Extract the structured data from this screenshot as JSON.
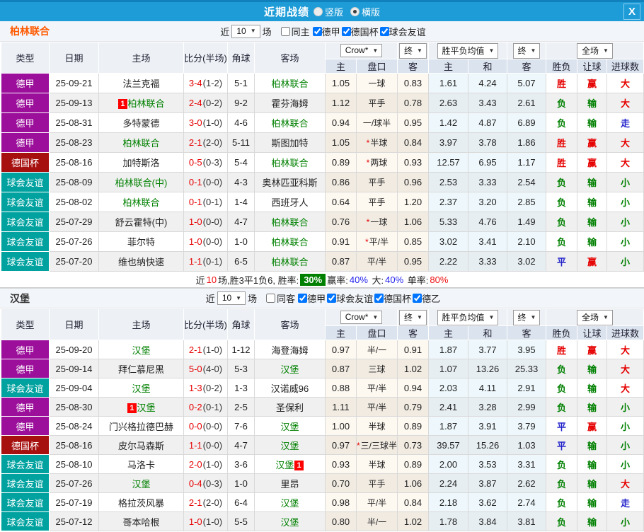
{
  "titlebar": {
    "title": "近期战绩",
    "radios": [
      {
        "label": "竖版",
        "checked": false
      },
      {
        "label": "横版",
        "checked": true
      }
    ],
    "close": "X"
  },
  "table_header": {
    "left_cols": [
      "类型",
      "日期",
      "主场",
      "比分(半场)",
      "角球",
      "客场"
    ],
    "sub_cols": [
      "主",
      "盘口",
      "客",
      "主",
      "和",
      "客",
      "胜负",
      "让球",
      "进球数"
    ],
    "dd_company": "Crow*",
    "dd_final1": "终",
    "dd_avg": "胜平负均值",
    "dd_final2": "终",
    "dd_scope": "全场"
  },
  "type_colors": {
    "德甲": "#9b0f9b",
    "德国杯": "#a6100f",
    "球会友谊": "#00a2a0",
    "德乙": "#9b0f9b"
  },
  "result_colors": {
    "胜": "#e60000",
    "负": "#008000",
    "平": "#2323cc",
    "赢": "#e60000",
    "输": "#008000",
    "大": "#e60000",
    "小": "#008000",
    "走": "#2323cc"
  },
  "sections": [
    {
      "team": "柏林联合",
      "name_color": "#ff5a00",
      "filter": {
        "near": "近",
        "count": "10",
        "games": "场",
        "same": "同主",
        "leagues": [
          {
            "label": "德甲",
            "checked": true
          },
          {
            "label": "德国杯",
            "checked": true
          },
          {
            "label": "球会友谊",
            "checked": true
          }
        ]
      },
      "rows": [
        {
          "type": "德甲",
          "date": "25-09-21",
          "home": "法兰克福",
          "home_green": false,
          "home_badge": "",
          "home_badge_pos": "",
          "away": "柏林联合",
          "away_green": true,
          "away_badge": "",
          "away_badge_pos": "",
          "score": "3-4",
          "half": "(1-2)",
          "corner": "5-1",
          "o_home": "1.05",
          "handicap": "一球",
          "handicap_star": false,
          "o_away": "0.83",
          "avg_home": "1.61",
          "avg_draw": "4.24",
          "avg_away": "5.07",
          "res_wdl": "胜",
          "res_handicap": "赢",
          "res_ou": "大"
        },
        {
          "type": "德甲",
          "date": "25-09-13",
          "home": "柏林联合",
          "home_green": true,
          "home_badge": "1",
          "home_badge_pos": "before",
          "away": "霍芬海姆",
          "away_green": false,
          "away_badge": "",
          "away_badge_pos": "",
          "score": "2-4",
          "half": "(0-2)",
          "corner": "9-2",
          "o_home": "1.12",
          "handicap": "平手",
          "handicap_star": false,
          "o_away": "0.78",
          "avg_home": "2.63",
          "avg_draw": "3.43",
          "avg_away": "2.61",
          "res_wdl": "负",
          "res_handicap": "输",
          "res_ou": "大"
        },
        {
          "type": "德甲",
          "date": "25-08-31",
          "home": "多特蒙德",
          "home_green": false,
          "home_badge": "",
          "home_badge_pos": "",
          "away": "柏林联合",
          "away_green": true,
          "away_badge": "",
          "away_badge_pos": "",
          "score": "3-0",
          "half": "(1-0)",
          "corner": "4-6",
          "o_home": "0.94",
          "handicap": "一/球半",
          "handicap_star": false,
          "o_away": "0.95",
          "avg_home": "1.42",
          "avg_draw": "4.87",
          "avg_away": "6.89",
          "res_wdl": "负",
          "res_handicap": "输",
          "res_ou": "走"
        },
        {
          "type": "德甲",
          "date": "25-08-23",
          "home": "柏林联合",
          "home_green": true,
          "home_badge": "",
          "home_badge_pos": "",
          "away": "斯图加特",
          "away_green": false,
          "away_badge": "",
          "away_badge_pos": "",
          "score": "2-1",
          "half": "(2-0)",
          "corner": "5-11",
          "o_home": "1.05",
          "handicap": "半球",
          "handicap_star": true,
          "o_away": "0.84",
          "avg_home": "3.97",
          "avg_draw": "3.78",
          "avg_away": "1.86",
          "res_wdl": "胜",
          "res_handicap": "赢",
          "res_ou": "大"
        },
        {
          "type": "德国杯",
          "date": "25-08-16",
          "home": "加特斯洛",
          "home_green": false,
          "home_badge": "",
          "home_badge_pos": "",
          "away": "柏林联合",
          "away_green": true,
          "away_badge": "",
          "away_badge_pos": "",
          "score": "0-5",
          "half": "(0-3)",
          "corner": "5-4",
          "o_home": "0.89",
          "handicap": "两球",
          "handicap_star": true,
          "o_away": "0.93",
          "avg_home": "12.57",
          "avg_draw": "6.95",
          "avg_away": "1.17",
          "res_wdl": "胜",
          "res_handicap": "赢",
          "res_ou": "大"
        },
        {
          "type": "球会友谊",
          "date": "25-08-09",
          "home": "柏林联合(中)",
          "home_green": true,
          "home_badge": "",
          "home_badge_pos": "",
          "away": "奥林匹亚科斯",
          "away_green": false,
          "away_badge": "",
          "away_badge_pos": "",
          "score": "0-1",
          "half": "(0-0)",
          "corner": "4-3",
          "o_home": "0.86",
          "handicap": "平手",
          "handicap_star": false,
          "o_away": "0.96",
          "avg_home": "2.53",
          "avg_draw": "3.33",
          "avg_away": "2.54",
          "res_wdl": "负",
          "res_handicap": "输",
          "res_ou": "小"
        },
        {
          "type": "球会友谊",
          "date": "25-08-02",
          "home": "柏林联合",
          "home_green": true,
          "home_badge": "",
          "home_badge_pos": "",
          "away": "西班牙人",
          "away_green": false,
          "away_badge": "",
          "away_badge_pos": "",
          "score": "0-1",
          "half": "(0-1)",
          "corner": "1-4",
          "o_home": "0.64",
          "handicap": "平手",
          "handicap_star": false,
          "o_away": "1.20",
          "avg_home": "2.37",
          "avg_draw": "3.20",
          "avg_away": "2.85",
          "res_wdl": "负",
          "res_handicap": "输",
          "res_ou": "小"
        },
        {
          "type": "球会友谊",
          "date": "25-07-29",
          "home": "舒云霍特(中)",
          "home_green": false,
          "home_badge": "",
          "home_badge_pos": "",
          "away": "柏林联合",
          "away_green": true,
          "away_badge": "",
          "away_badge_pos": "",
          "score": "1-0",
          "half": "(0-0)",
          "corner": "4-7",
          "o_home": "0.76",
          "handicap": "一球",
          "handicap_star": true,
          "o_away": "1.06",
          "avg_home": "5.33",
          "avg_draw": "4.76",
          "avg_away": "1.49",
          "res_wdl": "负",
          "res_handicap": "输",
          "res_ou": "小"
        },
        {
          "type": "球会友谊",
          "date": "25-07-26",
          "home": "菲尔特",
          "home_green": false,
          "home_badge": "",
          "home_badge_pos": "",
          "away": "柏林联合",
          "away_green": true,
          "away_badge": "",
          "away_badge_pos": "",
          "score": "1-0",
          "half": "(0-0)",
          "corner": "1-0",
          "o_home": "0.91",
          "handicap": "平/半",
          "handicap_star": true,
          "o_away": "0.85",
          "avg_home": "3.02",
          "avg_draw": "3.41",
          "avg_away": "2.10",
          "res_wdl": "负",
          "res_handicap": "输",
          "res_ou": "小"
        },
        {
          "type": "球会友谊",
          "date": "25-07-20",
          "home": "维也纳快速",
          "home_green": false,
          "home_badge": "",
          "home_badge_pos": "",
          "away": "柏林联合",
          "away_green": true,
          "away_badge": "",
          "away_badge_pos": "",
          "score": "1-1",
          "half": "(0-1)",
          "corner": "6-5",
          "o_home": "0.87",
          "handicap": "平/半",
          "handicap_star": false,
          "o_away": "0.95",
          "avg_home": "2.22",
          "avg_draw": "3.33",
          "avg_away": "3.02",
          "res_wdl": "平",
          "res_handicap": "赢",
          "res_ou": "小"
        }
      ],
      "summary": {
        "prefix": "近",
        "count": "10",
        "label1": "场,胜3平1负6, 胜率:",
        "rate": "30%",
        "label2": "赢率:",
        "pct2": "40%",
        "label3": "大:",
        "pct3": "40%",
        "label4": "单率:",
        "pct4": "80%"
      }
    },
    {
      "team": "汉堡",
      "name_color": "#333333",
      "filter": {
        "near": "近",
        "count": "10",
        "games": "场",
        "same": "同客",
        "leagues": [
          {
            "label": "德甲",
            "checked": true
          },
          {
            "label": "球会友谊",
            "checked": true
          },
          {
            "label": "德国杯",
            "checked": true
          },
          {
            "label": "德乙",
            "checked": true
          }
        ]
      },
      "rows": [
        {
          "type": "德甲",
          "date": "25-09-20",
          "home": "汉堡",
          "home_green": true,
          "home_badge": "",
          "home_badge_pos": "",
          "away": "海登海姆",
          "away_green": false,
          "away_badge": "",
          "away_badge_pos": "",
          "score": "2-1",
          "half": "(1-0)",
          "corner": "1-12",
          "o_home": "0.97",
          "handicap": "半/一",
          "handicap_star": false,
          "o_away": "0.91",
          "avg_home": "1.87",
          "avg_draw": "3.77",
          "avg_away": "3.95",
          "res_wdl": "胜",
          "res_handicap": "赢",
          "res_ou": "大"
        },
        {
          "type": "德甲",
          "date": "25-09-14",
          "home": "拜仁慕尼黑",
          "home_green": false,
          "home_badge": "",
          "home_badge_pos": "",
          "away": "汉堡",
          "away_green": true,
          "away_badge": "",
          "away_badge_pos": "",
          "score": "5-0",
          "half": "(4-0)",
          "corner": "5-3",
          "o_home": "0.87",
          "handicap": "三球",
          "handicap_star": false,
          "o_away": "1.02",
          "avg_home": "1.07",
          "avg_draw": "13.26",
          "avg_away": "25.33",
          "res_wdl": "负",
          "res_handicap": "输",
          "res_ou": "大"
        },
        {
          "type": "球会友谊",
          "date": "25-09-04",
          "home": "汉堡",
          "home_green": true,
          "home_badge": "",
          "home_badge_pos": "",
          "away": "汉诺威96",
          "away_green": false,
          "away_badge": "",
          "away_badge_pos": "",
          "score": "1-3",
          "half": "(0-2)",
          "corner": "1-3",
          "o_home": "0.88",
          "handicap": "平/半",
          "handicap_star": false,
          "o_away": "0.94",
          "avg_home": "2.03",
          "avg_draw": "4.11",
          "avg_away": "2.91",
          "res_wdl": "负",
          "res_handicap": "输",
          "res_ou": "大"
        },
        {
          "type": "德甲",
          "date": "25-08-30",
          "home": "汉堡",
          "home_green": true,
          "home_badge": "1",
          "home_badge_pos": "before",
          "away": "圣保利",
          "away_green": false,
          "away_badge": "",
          "away_badge_pos": "",
          "score": "0-2",
          "half": "(0-1)",
          "corner": "2-5",
          "o_home": "1.11",
          "handicap": "平/半",
          "handicap_star": false,
          "o_away": "0.79",
          "avg_home": "2.41",
          "avg_draw": "3.28",
          "avg_away": "2.99",
          "res_wdl": "负",
          "res_handicap": "输",
          "res_ou": "小"
        },
        {
          "type": "德甲",
          "date": "25-08-24",
          "home": "门兴格拉德巴赫",
          "home_green": false,
          "home_badge": "",
          "home_badge_pos": "",
          "away": "汉堡",
          "away_green": true,
          "away_badge": "",
          "away_badge_pos": "",
          "score": "0-0",
          "half": "(0-0)",
          "corner": "7-6",
          "o_home": "1.00",
          "handicap": "半球",
          "handicap_star": false,
          "o_away": "0.89",
          "avg_home": "1.87",
          "avg_draw": "3.91",
          "avg_away": "3.79",
          "res_wdl": "平",
          "res_handicap": "赢",
          "res_ou": "小"
        },
        {
          "type": "德国杯",
          "date": "25-08-16",
          "home": "皮尔马森斯",
          "home_green": false,
          "home_badge": "",
          "home_badge_pos": "",
          "away": "汉堡",
          "away_green": true,
          "away_badge": "",
          "away_badge_pos": "",
          "score": "1-1",
          "half": "(0-0)",
          "corner": "4-7",
          "o_home": "0.97",
          "handicap": "三/三球半",
          "handicap_star": true,
          "o_away": "0.73",
          "avg_home": "39.57",
          "avg_draw": "15.26",
          "avg_away": "1.03",
          "res_wdl": "平",
          "res_handicap": "输",
          "res_ou": "小"
        },
        {
          "type": "球会友谊",
          "date": "25-08-10",
          "home": "马洛卡",
          "home_green": false,
          "home_badge": "",
          "home_badge_pos": "",
          "away": "汉堡",
          "away_green": true,
          "away_badge": "1",
          "away_badge_pos": "after",
          "score": "2-0",
          "half": "(1-0)",
          "corner": "3-6",
          "o_home": "0.93",
          "handicap": "半球",
          "handicap_star": false,
          "o_away": "0.89",
          "avg_home": "2.00",
          "avg_draw": "3.53",
          "avg_away": "3.31",
          "res_wdl": "负",
          "res_handicap": "输",
          "res_ou": "小"
        },
        {
          "type": "球会友谊",
          "date": "25-07-26",
          "home": "汉堡",
          "home_green": true,
          "home_badge": "",
          "home_badge_pos": "",
          "away": "里昂",
          "away_green": false,
          "away_badge": "",
          "away_badge_pos": "",
          "score": "0-4",
          "half": "(0-3)",
          "corner": "1-0",
          "o_home": "0.70",
          "handicap": "平手",
          "handicap_star": false,
          "o_away": "1.06",
          "avg_home": "2.24",
          "avg_draw": "3.87",
          "avg_away": "2.62",
          "res_wdl": "负",
          "res_handicap": "输",
          "res_ou": "大"
        },
        {
          "type": "球会友谊",
          "date": "25-07-19",
          "home": "格拉茨风暴",
          "home_green": false,
          "home_badge": "",
          "home_badge_pos": "",
          "away": "汉堡",
          "away_green": true,
          "away_badge": "",
          "away_badge_pos": "",
          "score": "2-1",
          "half": "(2-0)",
          "corner": "6-4",
          "o_home": "0.98",
          "handicap": "平/半",
          "handicap_star": false,
          "o_away": "0.84",
          "avg_home": "2.18",
          "avg_draw": "3.62",
          "avg_away": "2.74",
          "res_wdl": "负",
          "res_handicap": "输",
          "res_ou": "走"
        },
        {
          "type": "球会友谊",
          "date": "25-07-12",
          "home": "哥本哈根",
          "home_green": false,
          "home_badge": "",
          "home_badge_pos": "",
          "away": "汉堡",
          "away_green": true,
          "away_badge": "",
          "away_badge_pos": "",
          "score": "1-0",
          "half": "(1-0)",
          "corner": "5-5",
          "o_home": "0.80",
          "handicap": "半/一",
          "handicap_star": false,
          "o_away": "1.02",
          "avg_home": "1.78",
          "avg_draw": "3.84",
          "avg_away": "3.81",
          "res_wdl": "负",
          "res_handicap": "输",
          "res_ou": "小"
        }
      ]
    }
  ]
}
